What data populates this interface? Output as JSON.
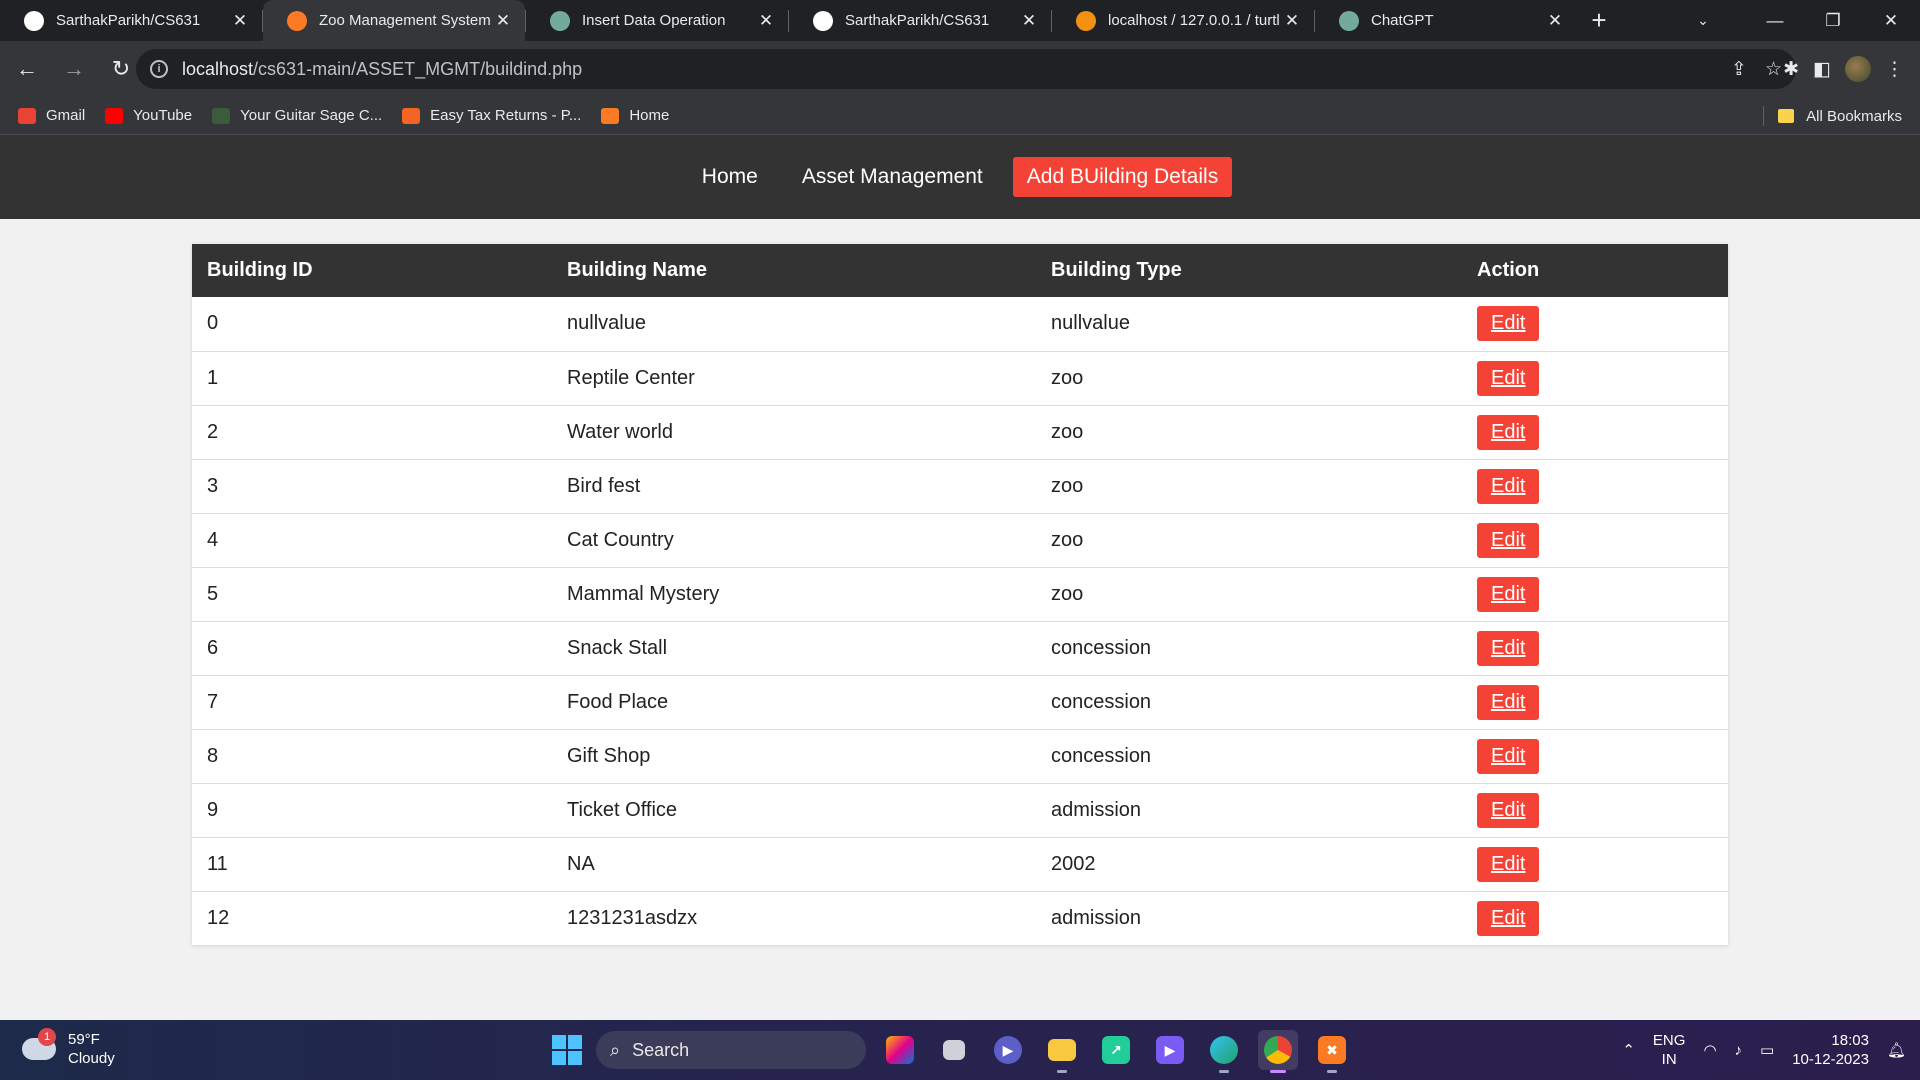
{
  "browser": {
    "tabs": [
      {
        "title": "SarthakParikh/CS631",
        "icon": "github-icon",
        "color": "#ffffff",
        "active": false
      },
      {
        "title": "Zoo Management System",
        "icon": "xampp-icon",
        "color": "#fb7a24",
        "active": true
      },
      {
        "title": "Insert Data Operation",
        "icon": "chatgpt-icon",
        "color": "#74aa9c",
        "active": false
      },
      {
        "title": "SarthakParikh/CS631",
        "icon": "github-icon",
        "color": "#ffffff",
        "active": false
      },
      {
        "title": "localhost / 127.0.0.1 / turtl",
        "icon": "phpmyadmin-icon",
        "color": "#f29111",
        "active": false
      },
      {
        "title": "ChatGPT",
        "icon": "chatgpt-icon",
        "color": "#74aa9c",
        "active": false
      }
    ],
    "url_host": "localhost",
    "url_path": "/cs631-main/ASSET_MGMT/buildind.php",
    "bookmarks": [
      {
        "label": "Gmail",
        "icon": "gmail-icon",
        "color": "#ea4335"
      },
      {
        "label": "YouTube",
        "icon": "youtube-icon",
        "color": "#ff0000"
      },
      {
        "label": "Your Guitar Sage C...",
        "icon": "guitar-sage-icon",
        "color": "#3c5a3c"
      },
      {
        "label": "Easy Tax Returns - P...",
        "icon": "ez-icon",
        "color": "#f26522"
      },
      {
        "label": "Home",
        "icon": "xampp-icon",
        "color": "#fb7a24"
      }
    ],
    "all_bookmarks": "All Bookmarks"
  },
  "site_nav": {
    "items": [
      {
        "label": "Home",
        "active": false
      },
      {
        "label": "Asset Management",
        "active": false
      },
      {
        "label": "Add BUilding Details",
        "active": true
      }
    ],
    "active_color": "#f44336"
  },
  "table": {
    "headers": [
      "Building ID",
      "Building Name",
      "Building Type",
      "Action"
    ],
    "edit_label": "Edit",
    "rows": [
      {
        "id": "0",
        "name": "nullvalue",
        "type": "nullvalue"
      },
      {
        "id": "1",
        "name": "Reptile Center",
        "type": "zoo"
      },
      {
        "id": "2",
        "name": "Water world",
        "type": "zoo"
      },
      {
        "id": "3",
        "name": "Bird fest",
        "type": "zoo"
      },
      {
        "id": "4",
        "name": "Cat Country",
        "type": "zoo"
      },
      {
        "id": "5",
        "name": "Mammal Mystery",
        "type": "zoo"
      },
      {
        "id": "6",
        "name": "Snack Stall",
        "type": "concession"
      },
      {
        "id": "7",
        "name": "Food Place",
        "type": "concession"
      },
      {
        "id": "8",
        "name": "Gift Shop",
        "type": "concession"
      },
      {
        "id": "9",
        "name": "Ticket Office",
        "type": "admission"
      },
      {
        "id": "11",
        "name": "NA",
        "type": "2002"
      },
      {
        "id": "12",
        "name": "1231231asdzx",
        "type": "admission"
      }
    ]
  },
  "taskbar": {
    "weather_temp": "59°F",
    "weather_desc": "Cloudy",
    "weather_badge": "1",
    "search_placeholder": "Search",
    "lang_line1": "ENG",
    "lang_line2": "IN",
    "time": "18:03",
    "date": "10-12-2023"
  }
}
